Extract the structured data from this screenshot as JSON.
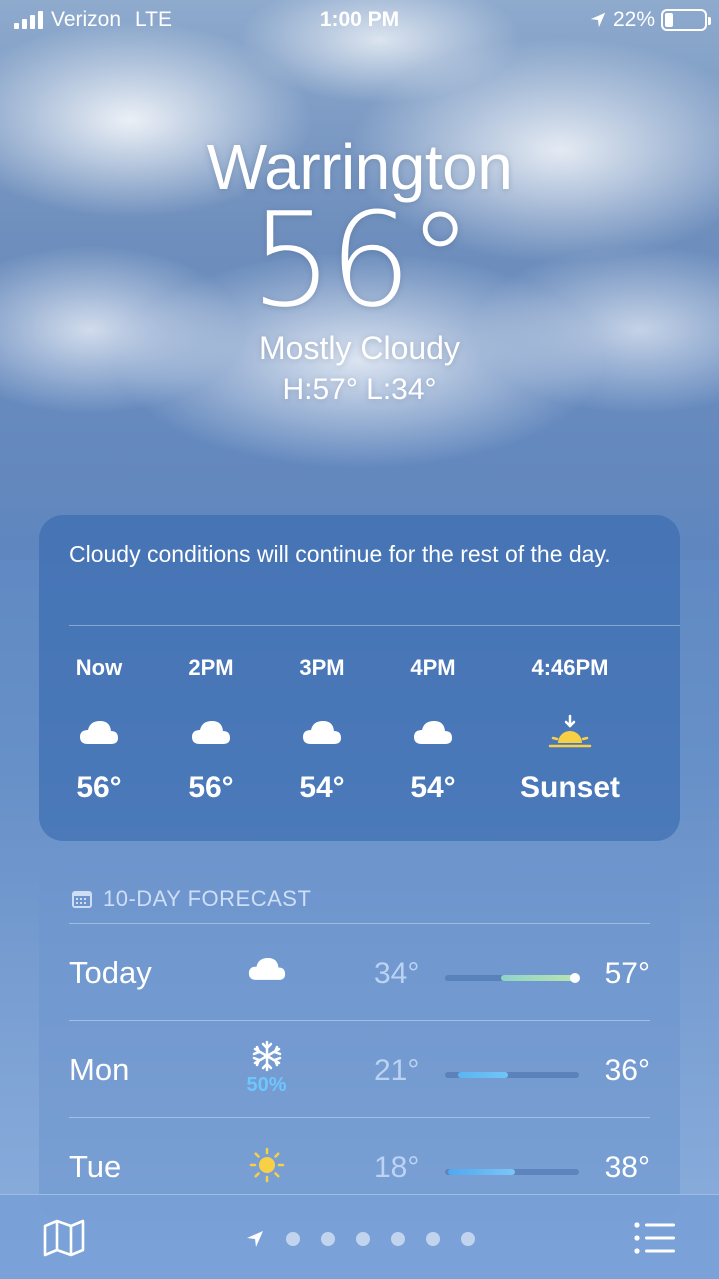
{
  "status_bar": {
    "carrier": "Verizon",
    "network": "LTE",
    "time": "1:00 PM",
    "battery_percent": "22%",
    "battery_level": 0.22
  },
  "current": {
    "city": "Warrington",
    "temperature": "56°",
    "condition": "Mostly Cloudy",
    "high_low": "H:57°  L:34°"
  },
  "hourly": {
    "summary": "Cloudy conditions will continue for the rest of the day.",
    "items": [
      {
        "time": "Now",
        "icon": "cloud-icon",
        "value": "56°"
      },
      {
        "time": "2PM",
        "icon": "cloud-icon",
        "value": "56°"
      },
      {
        "time": "3PM",
        "icon": "cloud-icon",
        "value": "54°"
      },
      {
        "time": "4PM",
        "icon": "cloud-icon",
        "value": "54°"
      },
      {
        "time": "4:46PM",
        "icon": "sunset-icon",
        "value": "Sunset"
      }
    ]
  },
  "forecast": {
    "header": "10-DAY FORECAST",
    "days": [
      {
        "day": "Today",
        "icon": "cloud-icon",
        "precip": "",
        "low": "34°",
        "high": "57°",
        "range_start": 0.42,
        "range_end": 0.97,
        "current_marker": 0.97,
        "colors": [
          "#8fd4c8",
          "#b9e3b0"
        ]
      },
      {
        "day": "Mon",
        "icon": "snowflake-icon",
        "precip": "50%",
        "low": "21°",
        "high": "36°",
        "range_start": 0.1,
        "range_end": 0.47,
        "colors": [
          "#5bb5f0",
          "#72c4f5"
        ]
      },
      {
        "day": "Tue",
        "icon": "sun-icon",
        "precip": "",
        "low": "18°",
        "high": "38°",
        "range_start": 0.02,
        "range_end": 0.52,
        "colors": [
          "#4fa8f0",
          "#7cc6f5"
        ]
      }
    ]
  },
  "colors": {
    "precip": "#6ec6ff",
    "sun": "#f7d046"
  },
  "tab_bar": {
    "page_count": 6
  }
}
